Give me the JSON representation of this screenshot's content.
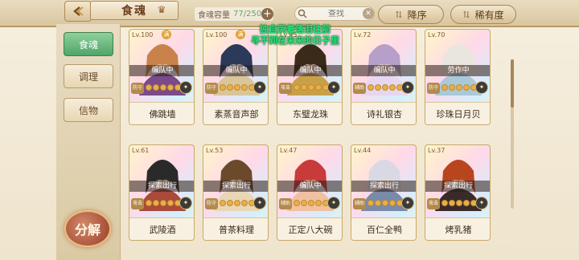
{
  "header": {
    "title": "食魂",
    "capacity_label": "食魂容量",
    "capacity_value": "77/250",
    "plus": "+",
    "search_placeholder": "查找",
    "sort_label": "降序",
    "rarity_label": "稀有度"
  },
  "sidebar": {
    "tabs": [
      {
        "label": "食魂"
      },
      {
        "label": "调理"
      },
      {
        "label": "信物"
      }
    ],
    "dismantle_label": "分解"
  },
  "overlay_text": {
    "line1": "独自哭着落泪往前",
    "line2": "寻不到在未来的日子里"
  },
  "cards": [
    {
      "level": "Lv.100",
      "status": "编队中",
      "role": "防守",
      "name": "佛跳墙",
      "mark": "满",
      "colors": [
        "#c9824a",
        "#7a4a8a"
      ]
    },
    {
      "level": "Lv.100",
      "status": "编队中",
      "role": "防守",
      "name": "素蒸音声部",
      "mark": "满",
      "colors": [
        "#2c3a5a",
        "#d9c59a"
      ]
    },
    {
      "level": "Lv.95",
      "status": "编队中",
      "role": "攻击",
      "name": "东璧龙珠",
      "mark": "",
      "colors": [
        "#3a2a1a",
        "#c9a04a"
      ]
    },
    {
      "level": "Lv.72",
      "status": "编队中",
      "role": "辅助",
      "name": "诗礼银杏",
      "mark": "",
      "colors": [
        "#b6a0c9",
        "#e6d6f0"
      ]
    },
    {
      "level": "Lv.70",
      "status": "劳作中",
      "role": "防守",
      "name": "珍珠日月贝",
      "mark": "",
      "colors": [
        "#e9e6e0",
        "#a9c9d9"
      ]
    },
    {
      "level": "Lv.61",
      "status": "探索出行",
      "role": "攻击",
      "name": "武陵酒",
      "mark": "",
      "colors": [
        "#2a2a2a",
        "#a94a3a"
      ]
    },
    {
      "level": "Lv.53",
      "status": "探索出行",
      "role": "防守",
      "name": "普茶料理",
      "mark": "",
      "colors": [
        "#6a4a2a",
        "#e9d6b6"
      ]
    },
    {
      "level": "Lv.47",
      "status": "编队中",
      "role": "辅助",
      "name": "正定八大碗",
      "mark": "",
      "colors": [
        "#c93a3a",
        "#f0c0a0"
      ]
    },
    {
      "level": "Lv.44",
      "status": "探索出行",
      "role": "辅助",
      "name": "百仁全鸭",
      "mark": "",
      "colors": [
        "#d9d9e6",
        "#7a8aa9"
      ]
    },
    {
      "level": "Lv.37",
      "status": "探索出行",
      "role": "攻击",
      "name": "烤乳猪",
      "mark": "",
      "colors": [
        "#b9451f",
        "#3a2a2a"
      ]
    }
  ],
  "accent": {
    "green": "#28e47a",
    "gold": "#c9a86a"
  }
}
